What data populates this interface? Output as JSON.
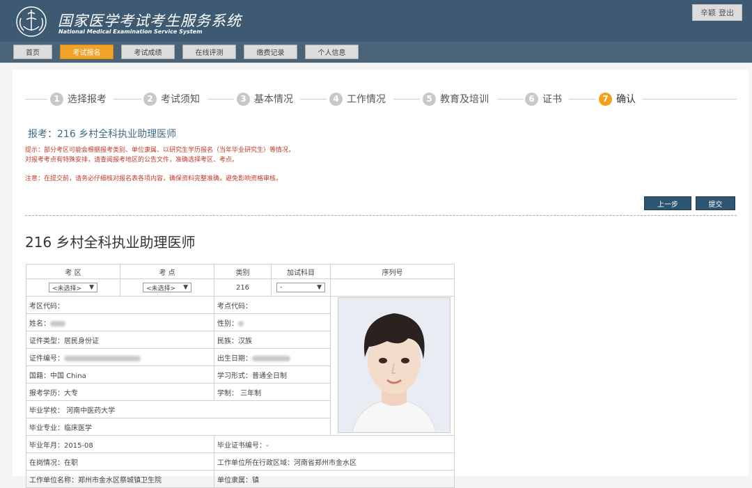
{
  "header": {
    "title": "国家医学考试考生服务系统",
    "subtitle": "National Medical Examination Service System",
    "user": "辛颖",
    "logout": "登出"
  },
  "nav": [
    {
      "label": "首页"
    },
    {
      "label": "考试报名"
    },
    {
      "label": "考试成绩"
    },
    {
      "label": "在线评测"
    },
    {
      "label": "缴费记录"
    },
    {
      "label": "个人信息"
    }
  ],
  "steps": [
    {
      "num": "1",
      "label": "选择报考"
    },
    {
      "num": "2",
      "label": "考试须知"
    },
    {
      "num": "3",
      "label": "基本情况"
    },
    {
      "num": "4",
      "label": "工作情况"
    },
    {
      "num": "5",
      "label": "教育及培训"
    },
    {
      "num": "6",
      "label": "证书"
    },
    {
      "num": "7",
      "label": "确认"
    }
  ],
  "exam_heading": "报考：216 乡村全科执业助理医师",
  "tips": [
    "提示：部分考区可能会根据报考类别、单位隶属、以研究生学历报名（当年毕业研究生）等情况，",
    "对报考考点有特殊安排，请查阅报考地区的公告文件，准确选择考区、考点。",
    "注意：在提交前，请务必仔细核对报名表各项内容，确保资料完整准确，避免影响资格审核。"
  ],
  "buttons": {
    "prev": "上一步",
    "submit": "提交"
  },
  "main_title": "216 乡村全科执业助理医师",
  "table": {
    "headers": [
      "考 区",
      "考 点",
      "类别",
      "加试科目",
      "序列号"
    ],
    "exam_area": "<未选择>",
    "exam_site": "<未选择>",
    "category": "216",
    "extra_subject": "-",
    "area_code": "考区代码：",
    "site_code": "考点代码：",
    "name": "姓名：",
    "gender": "性别：",
    "id_type": "证件类型：居民身份证",
    "ethnicity": "民族：汉族",
    "id_number": "证件编号：",
    "birth": "出生日期：",
    "nationality": "国籍：中国 China",
    "study_form": "学习形式：普通全日制",
    "education": "报考学历：大专",
    "school_length": "学制： 三年制",
    "school": "毕业学校： 河南中医药大学",
    "major": "毕业专业：临床医学",
    "grad_year": "毕业年月：2015-08",
    "cert_no": "毕业证书编号：-",
    "post_status": "在岗情况：在职",
    "work_region": "工作单位所在行政区域：河南省郑州市金水区",
    "employer": "工作单位名称：郑州市金水区祭城镇卫生院",
    "affiliation": "单位隶属：镇"
  },
  "colors": {
    "header_bg": "#3d5a72",
    "nav_active": "#f2a228",
    "step_active": "#f5a01a",
    "button": "#2d5470",
    "tip": "#c0392b"
  }
}
